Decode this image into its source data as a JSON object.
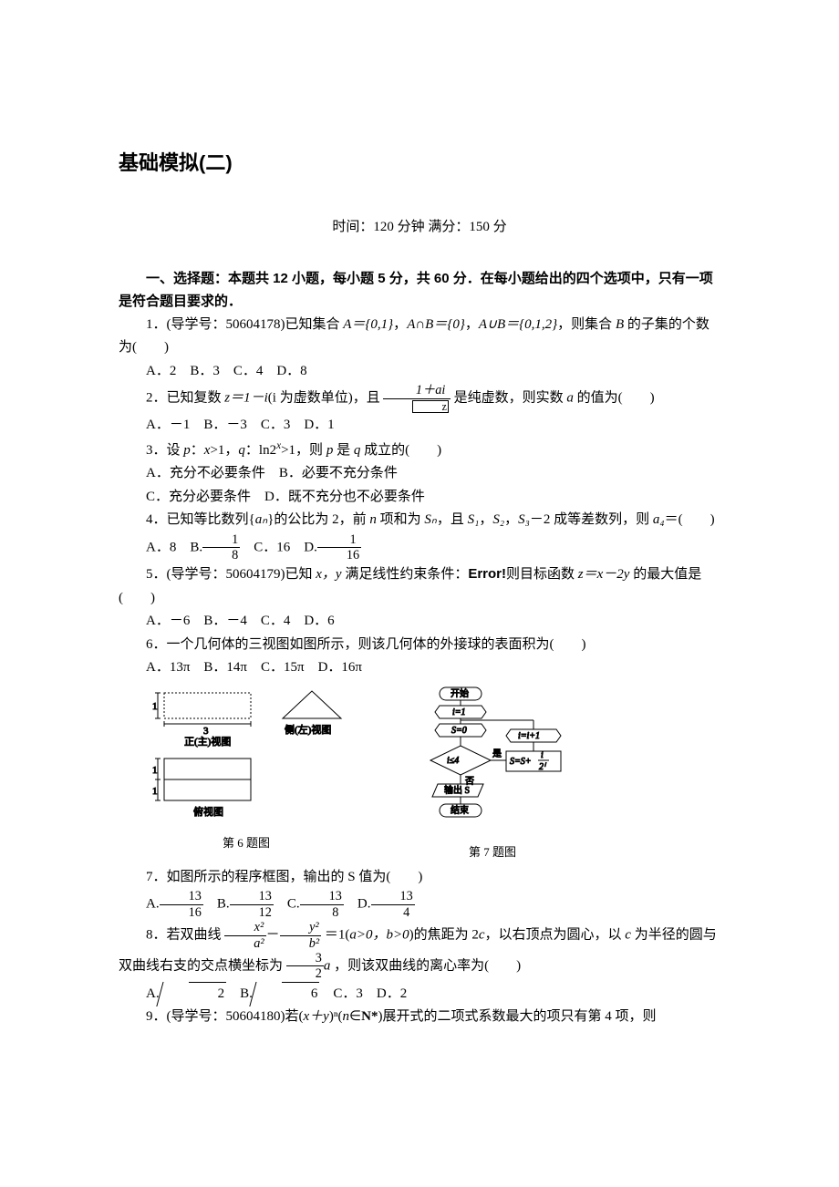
{
  "title": "基础模拟(二)",
  "meta": {
    "time_label": "时间：120 分钟",
    "gap": "   ",
    "score_label": "满分：150 分"
  },
  "section1": "一、选择题：本题共 12 小题，每小题 5 分，共 60 分．在每小题给出的四个选项中，只有一项是符合题目要求的．",
  "q1": {
    "text_a": "1．(导学号：50604178)已知集合 ",
    "A_eq": "A＝{0,1}",
    "text_b": "，",
    "inter": "A∩B＝{0}",
    "text_c": "，",
    "union": "A∪B＝{0,1,2}",
    "text_d": "，则集合 ",
    "B": "B",
    "text_e": " 的子集的个数为(　　)",
    "opts": "A．2　B．3　C．4　D．8"
  },
  "q2": {
    "text_a": "2．已知复数 ",
    "z_eq": "z＝1－i",
    "text_b": "(i 为虚数单位)，且",
    "frac_num": "1＋ai",
    "frac_den_note": "z",
    "text_c": "是纯虚数，则实数 ",
    "a": "a",
    "text_d": " 的值为(　　)",
    "opts": "A．－1　B．－3　C．3　D．1"
  },
  "q3": {
    "text": "3．设 p：x>1，q：ln2ˣ>1，则 p 是 q 成立的(　　)",
    "optA": "A．充分不必要条件　B．必要不充分条件",
    "optC": "C．充分必要条件　D．既不充分也不必要条件"
  },
  "q4": {
    "text_a": "4．已知等比数列{",
    "an": "aₙ",
    "text_b": "}的公比为 2，前 ",
    "n": "n",
    "text_c": " 项和为 ",
    "Sn": "Sₙ",
    "text_d": "，且 ",
    "S1": "S₁",
    "S2": "S₂",
    "S3": "S₃",
    "text_e": "－2 成等差数列，则 ",
    "a4": "a₄",
    "text_f": "＝(　　)",
    "A": "A．8",
    "B_pre": "B.",
    "B_num": "1",
    "B_den": "8",
    "C": "C．16",
    "D_pre": "D.",
    "D_num": "1",
    "D_den": "16"
  },
  "q5": {
    "text_a": "5．(导学号：50604179)已知 ",
    "xy": "x，y",
    "text_b": " 满足线性约束条件：",
    "err": "Error!",
    "text_c": "则目标函数 ",
    "z": "z＝x－2y",
    "text_d": " 的最大值是(　　)",
    "opts": "A．－6　B．－4　C．4　D．6"
  },
  "q6": {
    "text": "6．一个几何体的三视图如图所示，则该几何体的外接球的表面积为(　　)",
    "opts": "A．13π　B．14π　C．15π　D．16π"
  },
  "fig6": {
    "front": "正(主)视图",
    "side": "侧(左)视图",
    "top": "俯视图",
    "w": "3",
    "h": "1",
    "caption": "第 6 题图"
  },
  "fig7": {
    "start": "开始",
    "i1": "i=1",
    "s0": "S=0",
    "cond": "i≤4",
    "yes": "是",
    "no": "否",
    "update_s": "S=S+",
    "frac_num": "i",
    "frac_den": "2ⁱ",
    "incr": "i=i+1",
    "out": "输出 S",
    "end": "结束",
    "caption": "第 7 题图"
  },
  "q7": {
    "text": "7．如图所示的程序框图，输出的 S 值为(　　)",
    "A_pre": "A.",
    "A_num": "13",
    "A_den": "16",
    "B_pre": "B.",
    "B_num": "13",
    "B_den": "12",
    "C_pre": "C.",
    "C_num": "13",
    "C_den": "8",
    "D_pre": "D.",
    "D_num": "13",
    "D_den": "4"
  },
  "q8": {
    "text_a": "8．若双曲线",
    "x2": "x²",
    "a2": "a²",
    "y2": "y²",
    "b2": "b²",
    "text_b": "＝1(",
    "cond": "a>0，b>0",
    "text_c": ")的焦距为 2",
    "c": "c",
    "text_d": "，以右顶点为圆心，以 ",
    "c2": "c",
    "text_e": " 为半径的圆与双曲线右支的交点横坐标为",
    "frac_num": "3",
    "frac_den": "2",
    "frac_after": "a",
    "text_f": "，则该双曲线的离心率为(　　)",
    "A_pre": "A.",
    "A_rad": "2",
    "B_pre": "B.",
    "B_rad": "6",
    "C": "C．3",
    "D": "D．2"
  },
  "q9": {
    "text_a": "9．(导学号：50604180)若(",
    "xy": "x＋y",
    "text_b": ")ⁿ(",
    "n": "n",
    "text_c": "∈",
    "Nstar": "N*",
    "text_d": ")展开式的二项式系数最大的项只有第 4 项，则"
  }
}
